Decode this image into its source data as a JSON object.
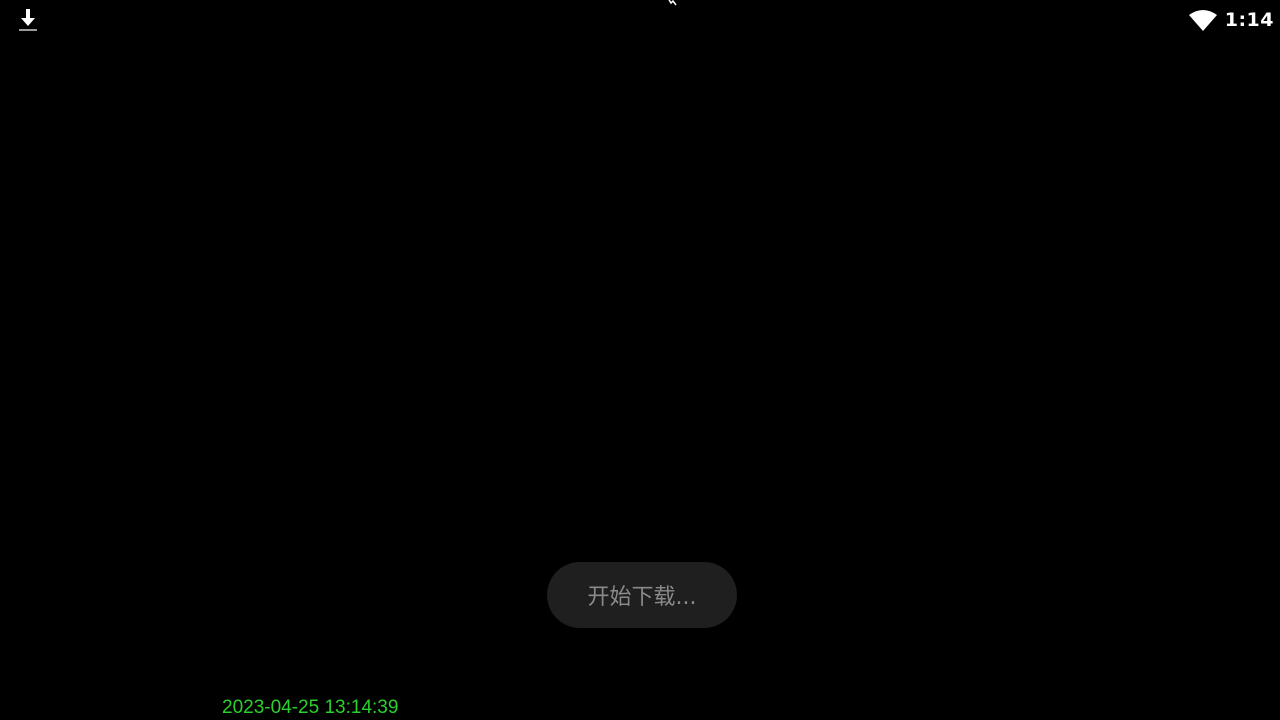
{
  "status_bar": {
    "notification_icon": "download-icon",
    "wifi_icon": "wifi-icon",
    "time": "1:14"
  },
  "toast": {
    "message": "开始下载..."
  },
  "overlay": {
    "timestamp": "2023-04-25 13:14:39"
  },
  "colors": {
    "background": "#000000",
    "toast_bg": "#1f1f1f",
    "toast_text": "#8a8a8a",
    "timestamp": "#2ad12a",
    "status_icons": "#ffffff"
  }
}
